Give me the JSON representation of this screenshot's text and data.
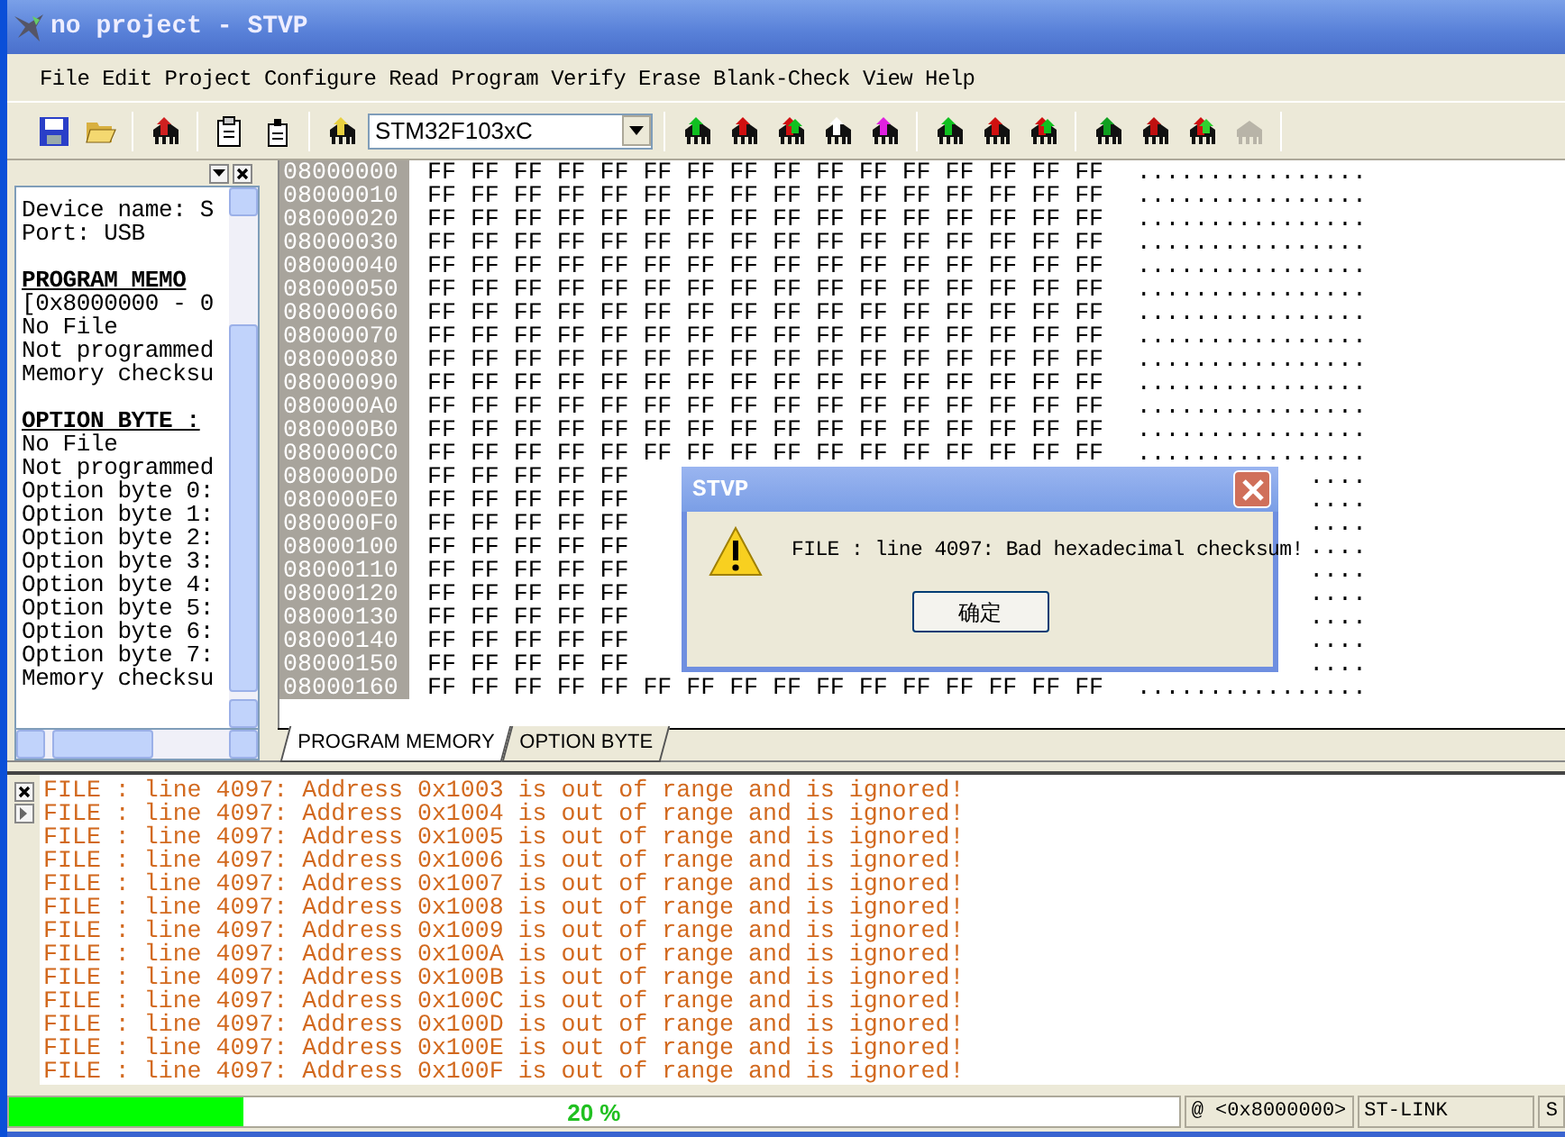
{
  "window": {
    "title": "no project - STVP"
  },
  "menu": [
    "File",
    "Edit",
    "Project",
    "Configure",
    "Read",
    "Program",
    "Verify",
    "Erase",
    "Blank-Check",
    "View",
    "Help"
  ],
  "toolbar": {
    "device": "STM32F103xC"
  },
  "info_panel": {
    "lines": [
      {
        "kind": "text",
        "text": "Device name: S"
      },
      {
        "kind": "text",
        "text": "Port: USB"
      },
      {
        "kind": "blank"
      },
      {
        "kind": "heading",
        "text": "PROGRAM MEMO"
      },
      {
        "kind": "text",
        "text": "[0x8000000 - 0"
      },
      {
        "kind": "text",
        "text": "No File"
      },
      {
        "kind": "text",
        "text": "Not programmed"
      },
      {
        "kind": "text",
        "text": "Memory checksu"
      },
      {
        "kind": "blank"
      },
      {
        "kind": "heading",
        "text": "OPTION BYTE :"
      },
      {
        "kind": "text",
        "text": "No File"
      },
      {
        "kind": "text",
        "text": "Not programmed"
      },
      {
        "kind": "text",
        "text": "Option byte 0:"
      },
      {
        "kind": "text",
        "text": "Option byte 1:"
      },
      {
        "kind": "text",
        "text": "Option byte 2:"
      },
      {
        "kind": "text",
        "text": "Option byte 3:"
      },
      {
        "kind": "text",
        "text": "Option byte 4:"
      },
      {
        "kind": "text",
        "text": "Option byte 5:"
      },
      {
        "kind": "text",
        "text": "Option byte 6:"
      },
      {
        "kind": "text",
        "text": "Option byte 7:"
      },
      {
        "kind": "text",
        "text": "Memory checksu"
      }
    ]
  },
  "hex_view": {
    "rows": [
      {
        "address": "08000000",
        "hex": "FF FF FF FF FF FF FF FF FF FF FF FF FF FF FF FF",
        "ascii": "................"
      },
      {
        "address": "08000010",
        "hex": "FF FF FF FF FF FF FF FF FF FF FF FF FF FF FF FF",
        "ascii": "................"
      },
      {
        "address": "08000020",
        "hex": "FF FF FF FF FF FF FF FF FF FF FF FF FF FF FF FF",
        "ascii": "................"
      },
      {
        "address": "08000030",
        "hex": "FF FF FF FF FF FF FF FF FF FF FF FF FF FF FF FF",
        "ascii": "................"
      },
      {
        "address": "08000040",
        "hex": "FF FF FF FF FF FF FF FF FF FF FF FF FF FF FF FF",
        "ascii": "................"
      },
      {
        "address": "08000050",
        "hex": "FF FF FF FF FF FF FF FF FF FF FF FF FF FF FF FF",
        "ascii": "................"
      },
      {
        "address": "08000060",
        "hex": "FF FF FF FF FF FF FF FF FF FF FF FF FF FF FF FF",
        "ascii": "................"
      },
      {
        "address": "08000070",
        "hex": "FF FF FF FF FF FF FF FF FF FF FF FF FF FF FF FF",
        "ascii": "................"
      },
      {
        "address": "08000080",
        "hex": "FF FF FF FF FF FF FF FF FF FF FF FF FF FF FF FF",
        "ascii": "................"
      },
      {
        "address": "08000090",
        "hex": "FF FF FF FF FF FF FF FF FF FF FF FF FF FF FF FF",
        "ascii": "................"
      },
      {
        "address": "080000A0",
        "hex": "FF FF FF FF FF FF FF FF FF FF FF FF FF FF FF FF",
        "ascii": "................"
      },
      {
        "address": "080000B0",
        "hex": "FF FF FF FF FF FF FF FF FF FF FF FF FF FF FF FF",
        "ascii": "................"
      },
      {
        "address": "080000C0",
        "hex": "FF FF FF FF FF FF FF FF FF FF FF FF FF FF FF FF",
        "ascii": "................"
      },
      {
        "address": "080000D0",
        "hex": "FF FF FF FF FF",
        "ascii": "...."
      },
      {
        "address": "080000E0",
        "hex": "FF FF FF FF FF",
        "ascii": "...."
      },
      {
        "address": "080000F0",
        "hex": "FF FF FF FF FF",
        "ascii": "...."
      },
      {
        "address": "08000100",
        "hex": "FF FF FF FF FF",
        "ascii": "...."
      },
      {
        "address": "08000110",
        "hex": "FF FF FF FF FF",
        "ascii": "...."
      },
      {
        "address": "08000120",
        "hex": "FF FF FF FF FF",
        "ascii": "...."
      },
      {
        "address": "08000130",
        "hex": "FF FF FF FF FF",
        "ascii": "...."
      },
      {
        "address": "08000140",
        "hex": "FF FF FF FF FF",
        "ascii": "...."
      },
      {
        "address": "08000150",
        "hex": "FF FF FF FF FF",
        "ascii": "...."
      },
      {
        "address": "08000160",
        "hex": "FF FF FF FF FF FF FF FF FF FF FF FF FF FF FF FF",
        "ascii": "................"
      }
    ],
    "tabs": [
      {
        "label": "PROGRAM MEMORY",
        "selected": true
      },
      {
        "label": "OPTION BYTE",
        "selected": false
      }
    ]
  },
  "dialog": {
    "title": "STVP",
    "message": "FILE : line 4097: Bad hexadecimal checksum!",
    "button": "确定"
  },
  "log": {
    "lines": [
      "FILE : line 4097: Address 0x1003 is out of range and is ignored!",
      "FILE : line 4097: Address 0x1004 is out of range and is ignored!",
      "FILE : line 4097: Address 0x1005 is out of range and is ignored!",
      "FILE : line 4097: Address 0x1006 is out of range and is ignored!",
      "FILE : line 4097: Address 0x1007 is out of range and is ignored!",
      "FILE : line 4097: Address 0x1008 is out of range and is ignored!",
      "FILE : line 4097: Address 0x1009 is out of range and is ignored!",
      "FILE : line 4097: Address 0x100A is out of range and is ignored!",
      "FILE : line 4097: Address 0x100B is out of range and is ignored!",
      "FILE : line 4097: Address 0x100C is out of range and is ignored!",
      "FILE : line 4097: Address 0x100D is out of range and is ignored!",
      "FILE : line 4097: Address 0x100E is out of range and is ignored!",
      "FILE : line 4097: Address 0x100F is out of range and is ignored!"
    ]
  },
  "status_bar": {
    "progress": {
      "level": 0.2,
      "reading": "20 %"
    },
    "panes": [
      "@ <0x8000000>",
      "ST-LINK",
      "S"
    ]
  }
}
